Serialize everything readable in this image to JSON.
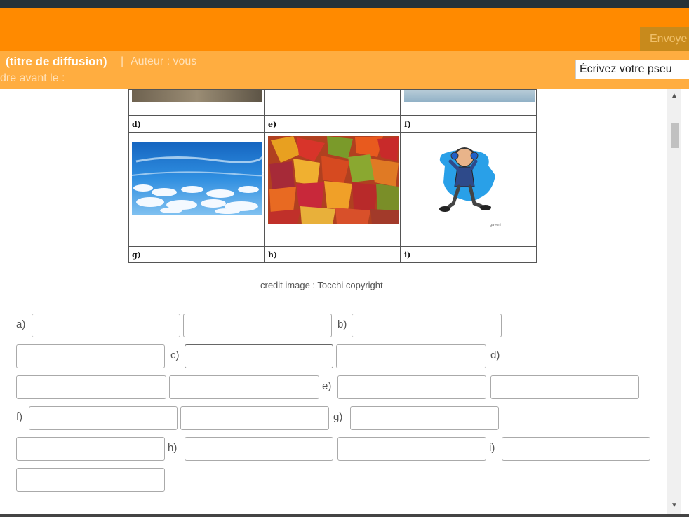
{
  "toolbar": {
    "send_label": "Envoye"
  },
  "header": {
    "doc_title": "(titre de diffusion)",
    "separator": "|",
    "author": "Auteur : vous",
    "deadline": "dre avant le :",
    "pseudo_placeholder": "Écrivez votre pseu"
  },
  "exercise": {
    "grid_labels": [
      "d)",
      "e)",
      "f)",
      "g)",
      "h)",
      "i)"
    ],
    "mascot_caption": "gaveri",
    "credit": "credit image : Tocchi copyright",
    "answer_letters": [
      "a)",
      "b)",
      "c)",
      "d)",
      "e)",
      "f)",
      "g)",
      "h)",
      "i)"
    ]
  },
  "colors": {
    "accent": "#ff8a00",
    "accent_light": "#ffad40"
  }
}
